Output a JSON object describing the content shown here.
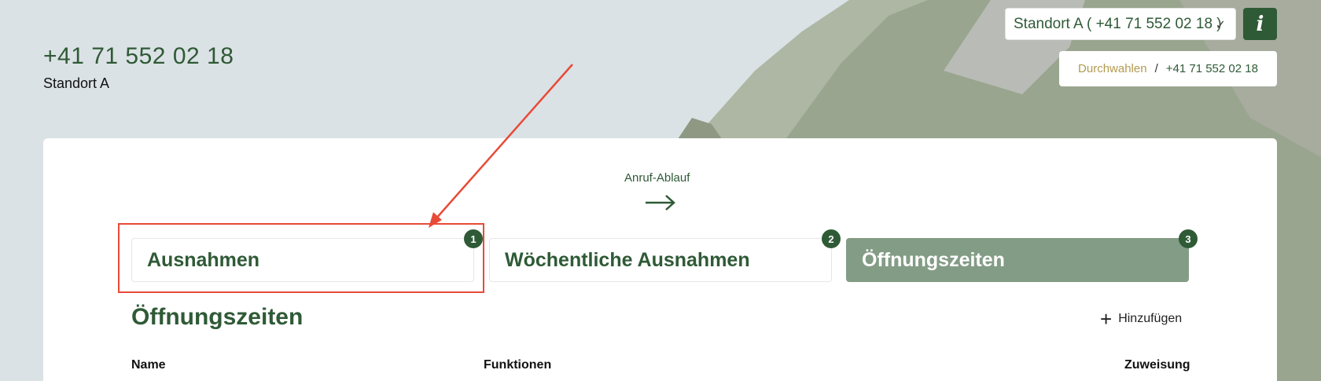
{
  "header": {
    "phone": "+41 71 552 02 18",
    "site_name": "Standort A"
  },
  "site_selector": {
    "value": "Standort A ( +41 71 552 02 18 )",
    "chevron_icon": "chevron-down-icon"
  },
  "info_button": {
    "label": "i"
  },
  "breadcrumb": {
    "link": "Durchwahlen",
    "separator": "/",
    "current": "+41 71 552 02 18"
  },
  "flow": {
    "label": "Anruf-Ablauf",
    "arrow_icon": "arrow-right-icon"
  },
  "steps": [
    {
      "label": "Ausnahmen",
      "badge": "1",
      "active": false
    },
    {
      "label": "Wöchentliche Ausnahmen",
      "badge": "2",
      "active": false
    },
    {
      "label": "Öffnungszeiten",
      "badge": "3",
      "active": true
    }
  ],
  "section": {
    "title": "Öffnungszeiten",
    "add_label": "Hinzufügen",
    "add_icon": "plus-icon"
  },
  "table": {
    "columns": [
      "Name",
      "Funktionen",
      "Zuweisung"
    ]
  },
  "colors": {
    "brand_green": "#2f5a36",
    "active_step": "#839c86",
    "breadcrumb_link": "#b39a4f",
    "annotation_red": "#e84a38"
  }
}
